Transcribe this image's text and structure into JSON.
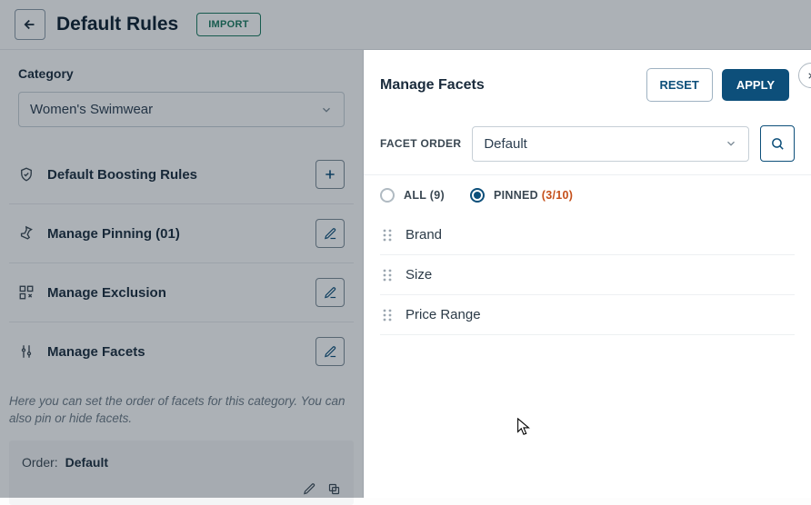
{
  "header": {
    "title": "Default Rules",
    "import_label": "IMPORT"
  },
  "category": {
    "label": "Category",
    "value": "Women's Swimwear"
  },
  "rules": {
    "boosting": "Default Boosting Rules",
    "pinning": "Manage Pinning (01)",
    "exclusion": "Manage Exclusion",
    "facets": "Manage Facets"
  },
  "facets_help": "Here you can set the order of facets for this category. You can also pin or hide facets.",
  "order_card": {
    "label": "Order:",
    "value": "Default"
  },
  "panel": {
    "title": "Manage Facets",
    "reset": "RESET",
    "apply": "APPLY",
    "facet_order_label": "FACET ORDER",
    "facet_order_value": "Default",
    "tabs": {
      "all_label": "ALL",
      "all_count": "(9)",
      "pinned_label": "PINNED",
      "pinned_count": "(3/10)"
    },
    "items": [
      "Brand",
      "Size",
      "Price Range"
    ]
  }
}
